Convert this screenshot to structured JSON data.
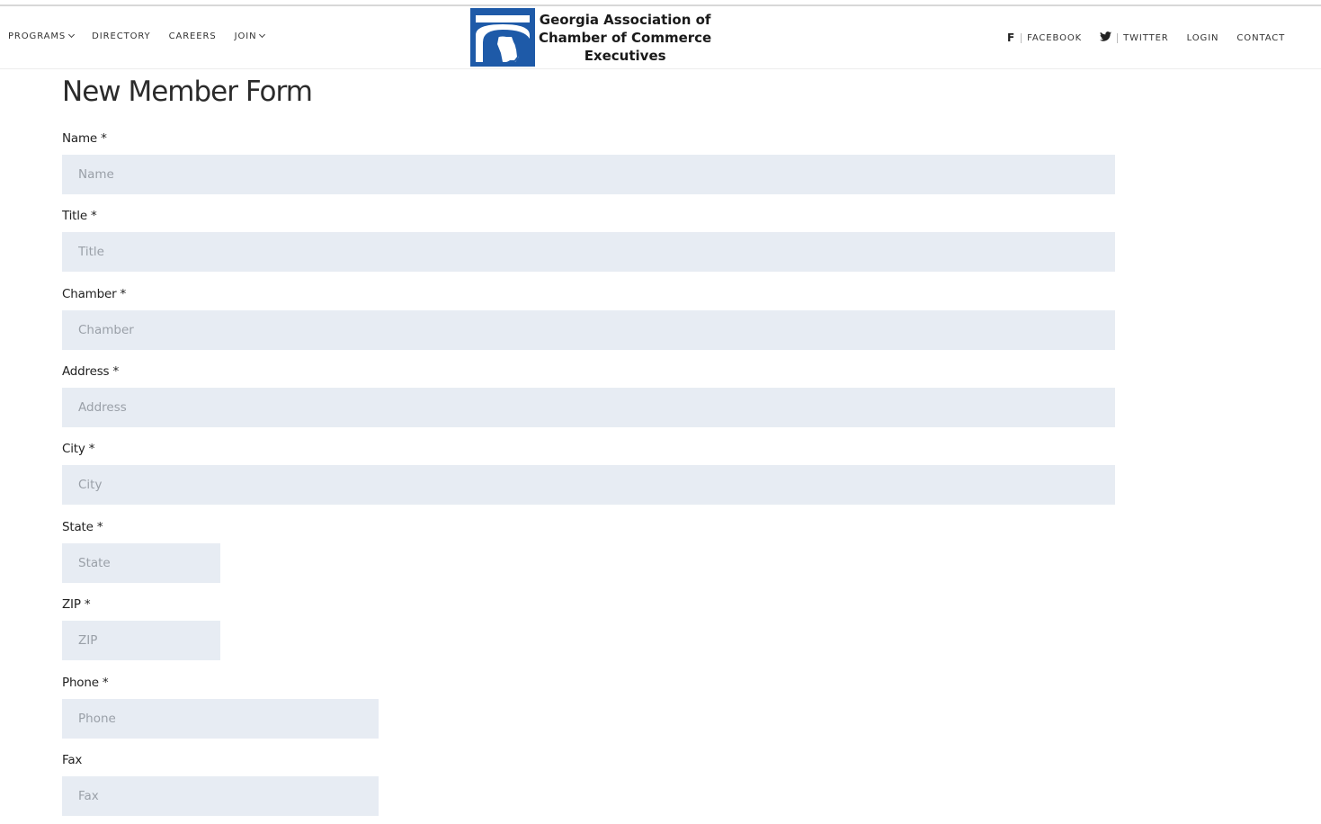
{
  "header": {
    "nav_left": [
      {
        "label": "PROGRAMS",
        "has_dropdown": true
      },
      {
        "label": "DIRECTORY",
        "has_dropdown": false
      },
      {
        "label": "CAREERS",
        "has_dropdown": false
      },
      {
        "label": "JOIN",
        "has_dropdown": true
      }
    ],
    "logo": {
      "line1": "Georgia Association of",
      "line2": "Chamber of Commerce",
      "line3": "Executives",
      "brand_color": "#1e5aa8"
    },
    "nav_right": {
      "facebook_icon": "f",
      "facebook_label": "FACEBOOK",
      "twitter_icon": "twitter-bird",
      "twitter_label": "TWITTER",
      "login_label": "LOGIN",
      "contact_label": "CONTACT"
    }
  },
  "form": {
    "title": "New Member Form",
    "fields": [
      {
        "label": "Name *",
        "placeholder": "Name",
        "value": ""
      },
      {
        "label": "Title *",
        "placeholder": "Title",
        "value": ""
      },
      {
        "label": "Chamber *",
        "placeholder": "Chamber",
        "value": ""
      },
      {
        "label": "Address *",
        "placeholder": "Address",
        "value": ""
      },
      {
        "label": "City *",
        "placeholder": "City",
        "value": ""
      },
      {
        "label": "State *",
        "placeholder": "State",
        "value": ""
      },
      {
        "label": "ZIP *",
        "placeholder": "ZIP",
        "value": ""
      },
      {
        "label": "Phone *",
        "placeholder": "Phone",
        "value": ""
      },
      {
        "label": "Fax",
        "placeholder": "Fax",
        "value": ""
      }
    ]
  }
}
